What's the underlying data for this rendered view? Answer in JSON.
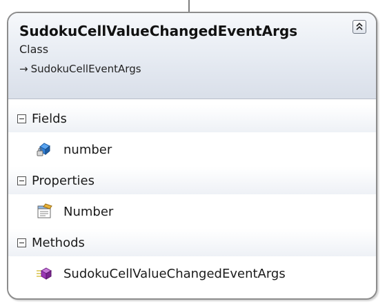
{
  "class": {
    "name": "SudokuCellValueChangedEventArgs",
    "kind": "Class",
    "base_arrow": "→",
    "base_type": "SudokuCellEventArgs"
  },
  "sections": {
    "fields": {
      "label": "Fields",
      "members": [
        {
          "label": "number",
          "icon": "protected-field-icon"
        }
      ]
    },
    "properties": {
      "label": "Properties",
      "members": [
        {
          "label": "Number",
          "icon": "property-icon"
        }
      ]
    },
    "methods": {
      "label": "Methods",
      "members": [
        {
          "label": "SudokuCellValueChangedEventArgs",
          "icon": "constructor-method-icon"
        }
      ]
    }
  },
  "colors": {
    "header_gradient_top": "#f6f8fb",
    "header_gradient_bottom": "#d9dfe9",
    "border": "#8c8c8c",
    "field_icon": "#2f7fd8",
    "method_icon": "#9b37b5"
  }
}
